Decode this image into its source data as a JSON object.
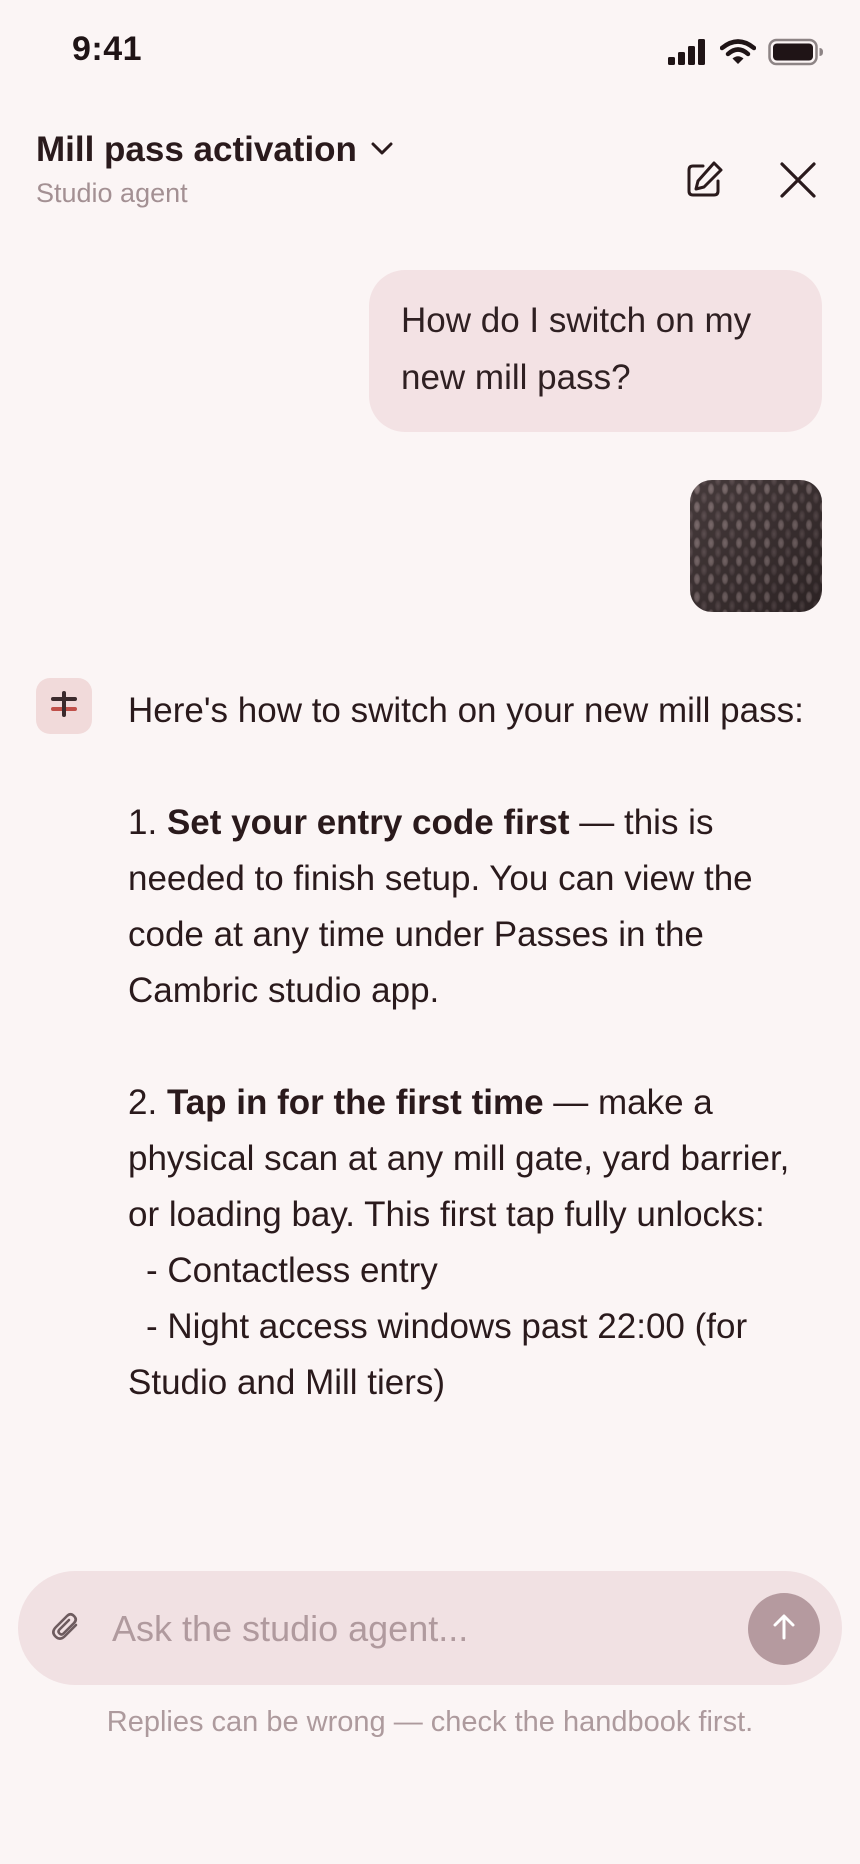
{
  "status_bar": {
    "time": "9:41",
    "icons": [
      "signal-icon",
      "wifi-icon",
      "battery-icon"
    ]
  },
  "header": {
    "title": "Mill pass activation",
    "subtitle": "Studio agent",
    "icons": [
      "chevron-down-icon",
      "compose-icon",
      "close-icon"
    ]
  },
  "conversation": {
    "user_message": "How do I switch on my new mill pass?",
    "user_attachment": "knit-fabric-thumbnail",
    "agent": {
      "intro": "Here's how to switch on your new mill pass:",
      "step1_num": "1.",
      "step1_title": "Set your entry code first",
      "step1_body": " — this is needed to finish setup. You can view the code at any time under Passes in the Cambric studio app.",
      "step2_num": "2.",
      "step2_title": "Tap in for the first time",
      "step2_body": " — make a physical scan at any mill gate, yard barrier, or loading bay. This first tap fully unlocks:",
      "bullets": [
        "- Contactless entry",
        "- Night access windows past 22:00 (for Studio and Mill tiers)"
      ]
    }
  },
  "composer": {
    "placeholder": "Ask the studio agent...",
    "value": ""
  },
  "disclaimer": "Replies can be wrong — check the handbook first.",
  "colors": {
    "background": "#fbf5f5",
    "bubble": "#f3e2e4",
    "accent": "#b59a9f",
    "avatar_bg": "#f1dada"
  }
}
